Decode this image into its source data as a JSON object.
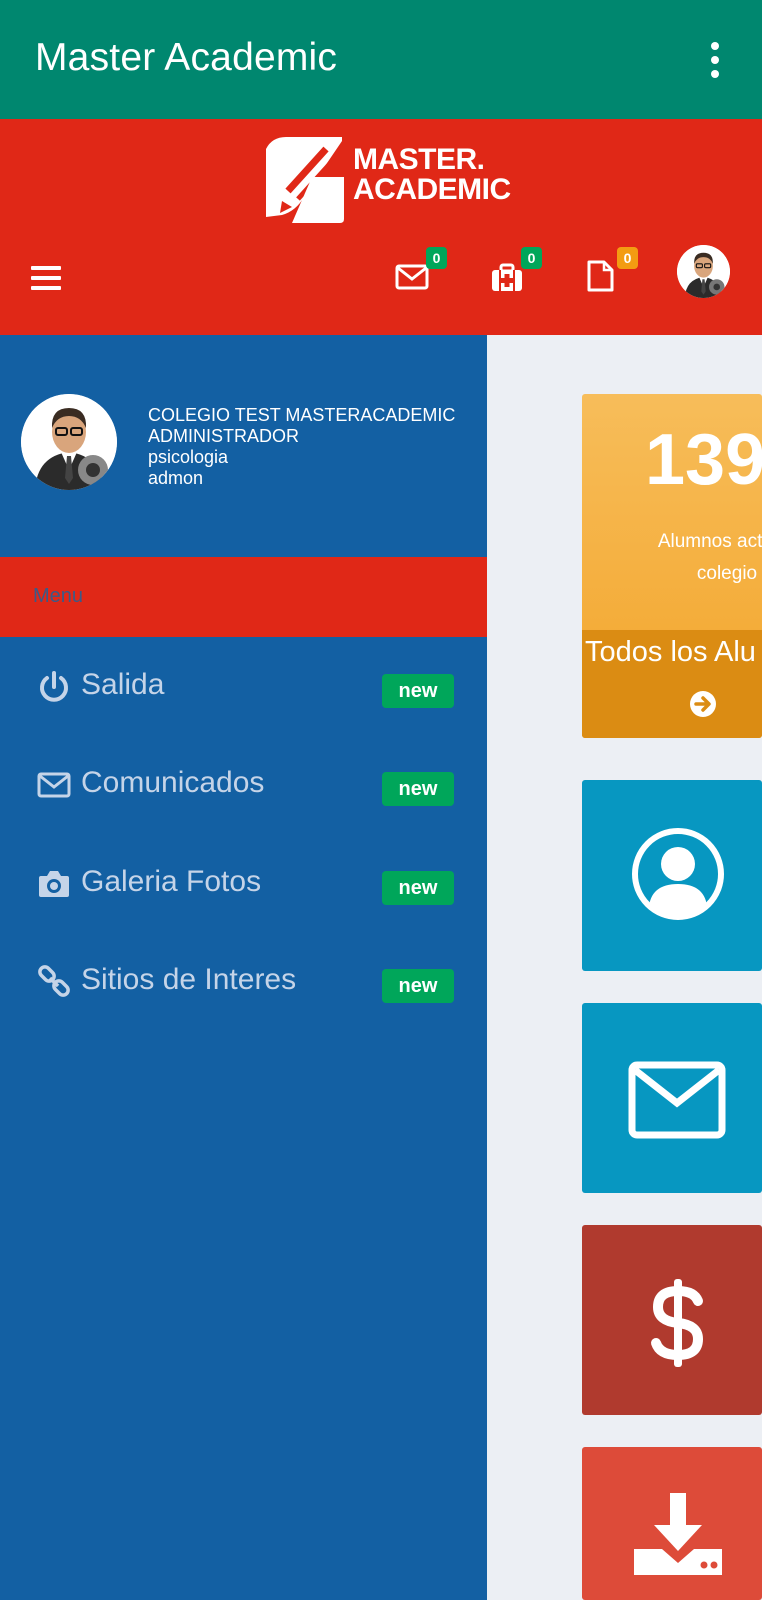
{
  "app_bar": {
    "title": "Master Academic",
    "menu_icon": "more-vert-icon"
  },
  "header": {
    "logo_line1": "MASTER.",
    "logo_line2": "ACADEMIC",
    "notifications": [
      {
        "icon": "envelope-icon",
        "count": "0",
        "color": "#00a65a"
      },
      {
        "icon": "medkit-icon",
        "count": "0",
        "color": "#00a65a"
      },
      {
        "icon": "file-icon",
        "count": "0",
        "color": "#f39c12"
      }
    ]
  },
  "sidebar": {
    "user": {
      "line1": "COLEGIO TEST MASTERACADEMIC",
      "line2": "ADMINISTRADOR",
      "line3": "psicologia",
      "line4": "admon"
    },
    "menu_header": "Menu",
    "items": [
      {
        "icon": "power-icon",
        "label": "Salida",
        "badge": "new"
      },
      {
        "icon": "envelope-icon",
        "label": "Comunicados",
        "badge": "new"
      },
      {
        "icon": "camera-icon",
        "label": "Galeria Fotos",
        "badge": "new"
      },
      {
        "icon": "link-icon",
        "label": "Sitios de Interes",
        "badge": "new"
      }
    ]
  },
  "tiles": {
    "students": {
      "count": "139",
      "subtitle_line1": "Alumnos activos",
      "subtitle_line2": "colegio",
      "footer": "Todos los Alu",
      "footer_icon": "arrow-circle-right-icon"
    },
    "icons": [
      "user-circle-icon",
      "envelope-icon",
      "dollar-icon",
      "download-icon"
    ]
  },
  "colors": {
    "app_bar": "#00876f",
    "header": "#e02817",
    "sidebar": "#1360a3",
    "badge_green": "#00a65a",
    "badge_orange": "#f39c12",
    "tile_yellow": "#f3a52b",
    "tile_blue": "#0797c1",
    "tile_red_dark": "#b03a2e",
    "tile_red": "#dd4b39"
  }
}
